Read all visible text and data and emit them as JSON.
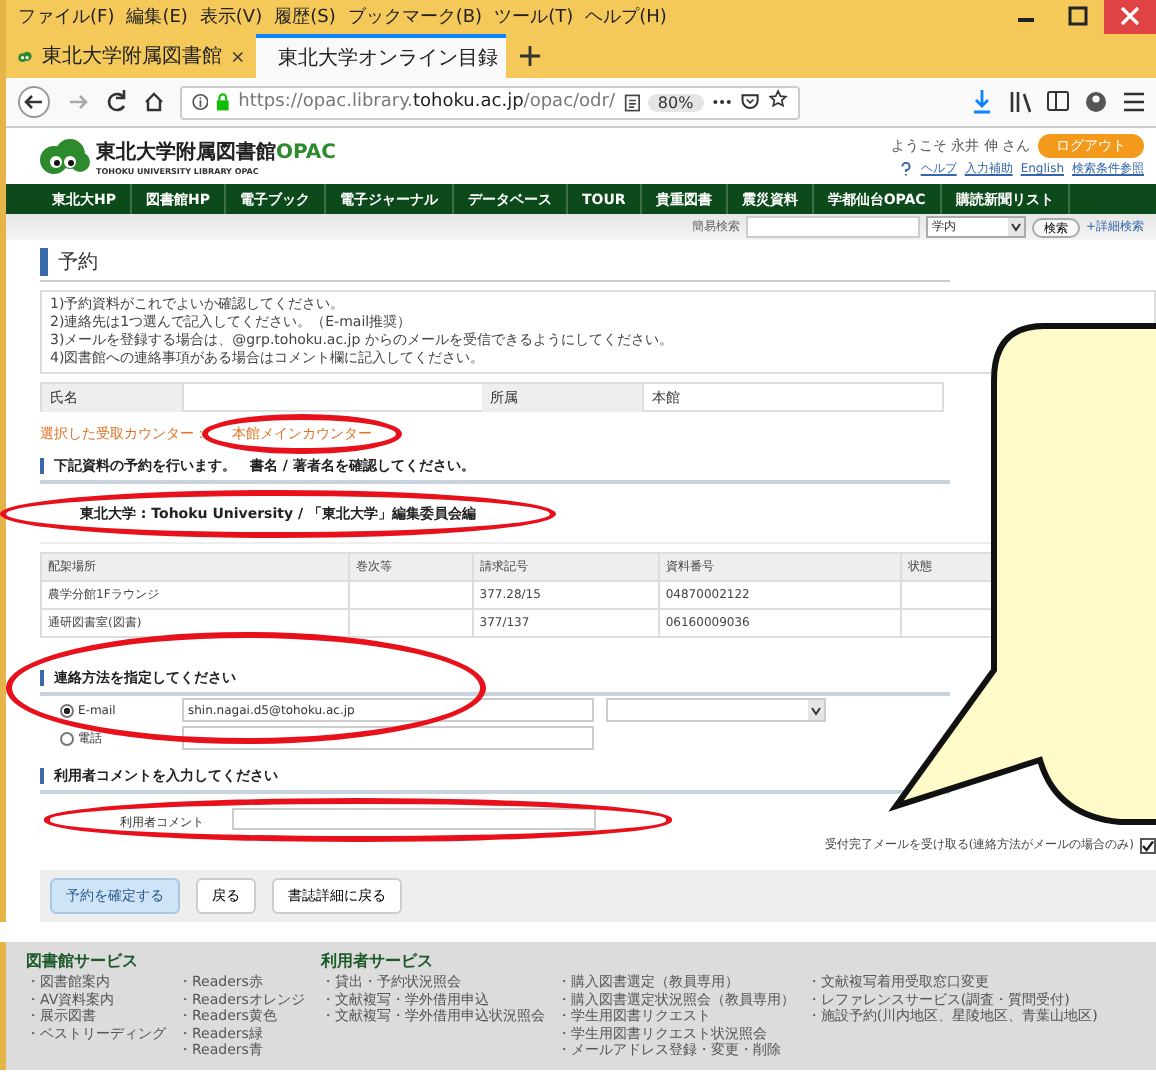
{
  "browser": {
    "menu": [
      "ファイル(F)",
      "編集(E)",
      "表示(V)",
      "履歴(S)",
      "ブックマーク(B)",
      "ツール(T)",
      "ヘルプ(H)"
    ],
    "tabs": [
      {
        "label": "東北大学附属図書館",
        "selected": false
      },
      {
        "label": "東北大学オンライン目録",
        "selected": true
      }
    ],
    "url": {
      "prefix": "https://opac.library.",
      "domain": "tohoku.ac.jp",
      "path": "/opac/odr/"
    },
    "zoom": "80%"
  },
  "site": {
    "logo_title": "東北大学附属図書館",
    "logo_accent": "OPAC",
    "logo_subtitle": "TOHOKU UNIVERSITY LIBRARY OPAC",
    "welcome": "ようこそ 永井 伸 さん",
    "logout": "ログアウト",
    "links": [
      "ヘルプ",
      "入力補助",
      "English",
      "検索条件参照"
    ],
    "nav": [
      "東北大HP",
      "図書館HP",
      "電子ブック",
      "電子ジャーナル",
      "データベース",
      "TOUR",
      "貴重図書",
      "震災資料",
      "学都仙台OPAC",
      "購読新聞リスト"
    ],
    "search": {
      "label": "簡易検索",
      "scope": "学内",
      "button": "検索",
      "advanced": "+詳細検索"
    }
  },
  "form": {
    "heading": "予約",
    "instructions": [
      "1)予約資料がこれでよいか確認してください。",
      "2)連絡先は1つ選んで記入してください。（E-mail推奨）",
      "3)メールを登録する場合は、@grp.tohoku.ac.jp からのメールを受信できるようにしてください。",
      "4)図書館への連絡事項がある場合はコメント欄に記入してください。"
    ],
    "user": [
      {
        "label": "氏名"
      },
      {
        "label": "所属",
        "value": "本館"
      }
    ],
    "counter": {
      "label": "選択した受取カウンター：",
      "value": "本館メインカウンター",
      "highlighted": true
    },
    "items_heading": "下記資料の予約を行います。　書名 / 著者名を確認してください。",
    "book": {
      "title": "東北大学 : Tohoku University / 「東北大学」編集委員会編",
      "highlighted": true
    },
    "table": {
      "columns": [
        "配架場所",
        "巻次等",
        "請求記号",
        "資料番号",
        "状態"
      ],
      "rows": [
        [
          "農学分館1Fラウンジ",
          "",
          "377.28/15",
          "04870002122",
          ""
        ],
        [
          "通研図書室(図書)",
          "",
          "377/137",
          "06160009036",
          ""
        ]
      ]
    },
    "contact": {
      "heading": "連絡方法を指定してください",
      "highlighted": true,
      "options": [
        {
          "label": "E-mail",
          "selected": true,
          "value": "shin.nagai.d5@tohoku.ac.jp"
        },
        {
          "label": "電話",
          "selected": false
        }
      ]
    },
    "comment": {
      "heading": "利用者コメントを入力してください",
      "label": "利用者コメント",
      "highlighted": true
    },
    "receipt": {
      "label": "受付完了メールを受け取る(連絡方法がメールの場合のみ)",
      "checked": true
    },
    "buttons": [
      {
        "label": "予約を確定する",
        "kind": "primary"
      },
      {
        "label": "戻る",
        "kind": "normal"
      },
      {
        "label": "書誌詳細に戻る",
        "kind": "normal"
      }
    ]
  },
  "footer": [
    {
      "heading": "図書館サービス",
      "groups": [
        [
          "・図書館案内",
          "・AV資料案内",
          "・展示図書",
          "・ベストリーディング"
        ],
        [
          "・Readers赤",
          "・Readersオレンジ",
          "・Readers黄色",
          "・Readers緑",
          "・Readers青"
        ]
      ]
    },
    {
      "heading": "利用者サービス",
      "groups": [
        [
          "・貸出・予約状況照会",
          "・文献複写・学外借用申込",
          "・文献複写・学外借用申込状況照会"
        ],
        [
          "・購入図書選定（教員専用）",
          "・購入図書選定状況照会（教員専用）",
          "・学生用図書リクエスト",
          "・学生用図書リクエスト状況照会",
          "・メールアドレス登録・変更・削除"
        ],
        [
          "・文献複写着用受取窓口変更",
          "・レファレンスサービス(調査・質問受付)",
          "・施設予約(川内地区、星陵地区、青葉山地区)"
        ]
      ]
    }
  ]
}
